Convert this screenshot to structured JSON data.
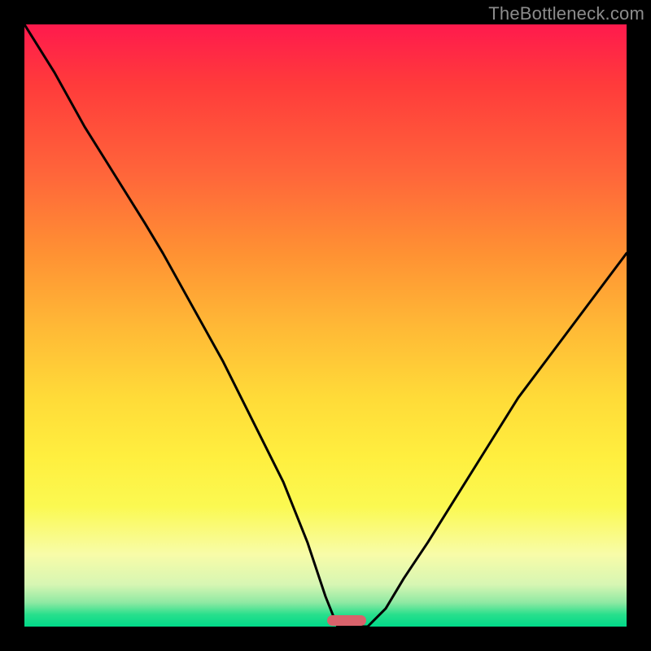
{
  "watermark": "TheBottleneck.com",
  "marker": {
    "color": "#d9626b",
    "x_pct": 53.5,
    "y_pct": 99.0,
    "width_pct": 6.5,
    "height_pct": 1.8
  },
  "chart_data": {
    "type": "line",
    "title": "",
    "xlabel": "",
    "ylabel": "",
    "xlim": [
      0,
      100
    ],
    "ylim": [
      0,
      100
    ],
    "grid": false,
    "legend": false,
    "gradient_stops": [
      {
        "pct": 0,
        "color": "#ff1a4d"
      },
      {
        "pct": 10,
        "color": "#ff3b3b"
      },
      {
        "pct": 25,
        "color": "#ff663a"
      },
      {
        "pct": 38,
        "color": "#ff9133"
      },
      {
        "pct": 50,
        "color": "#ffb836"
      },
      {
        "pct": 62,
        "color": "#ffdb38"
      },
      {
        "pct": 72,
        "color": "#ffef3f"
      },
      {
        "pct": 80,
        "color": "#fbf951"
      },
      {
        "pct": 88,
        "color": "#f8fca8"
      },
      {
        "pct": 93,
        "color": "#d7f6b3"
      },
      {
        "pct": 96,
        "color": "#8fe9a3"
      },
      {
        "pct": 98,
        "color": "#28df8c"
      },
      {
        "pct": 100,
        "color": "#00d989"
      }
    ],
    "series": [
      {
        "name": "bottleneck-curve",
        "stroke": "#000000",
        "stroke_width": 3,
        "x": [
          0,
          5,
          10,
          15,
          20,
          23,
          28,
          33,
          38,
          43,
          47,
          50,
          52,
          57,
          60,
          63,
          67,
          72,
          77,
          82,
          88,
          94,
          100
        ],
        "y": [
          100,
          92,
          83,
          75,
          67,
          62,
          53,
          44,
          34,
          24,
          14,
          5,
          0,
          0,
          3,
          8,
          14,
          22,
          30,
          38,
          46,
          54,
          62
        ]
      }
    ],
    "annotations": [
      {
        "type": "pill-marker",
        "name": "optimum-marker",
        "x_center": 53.5,
        "y_center": 0.9,
        "width": 6.5,
        "height": 1.8,
        "color": "#d9626b"
      }
    ]
  }
}
